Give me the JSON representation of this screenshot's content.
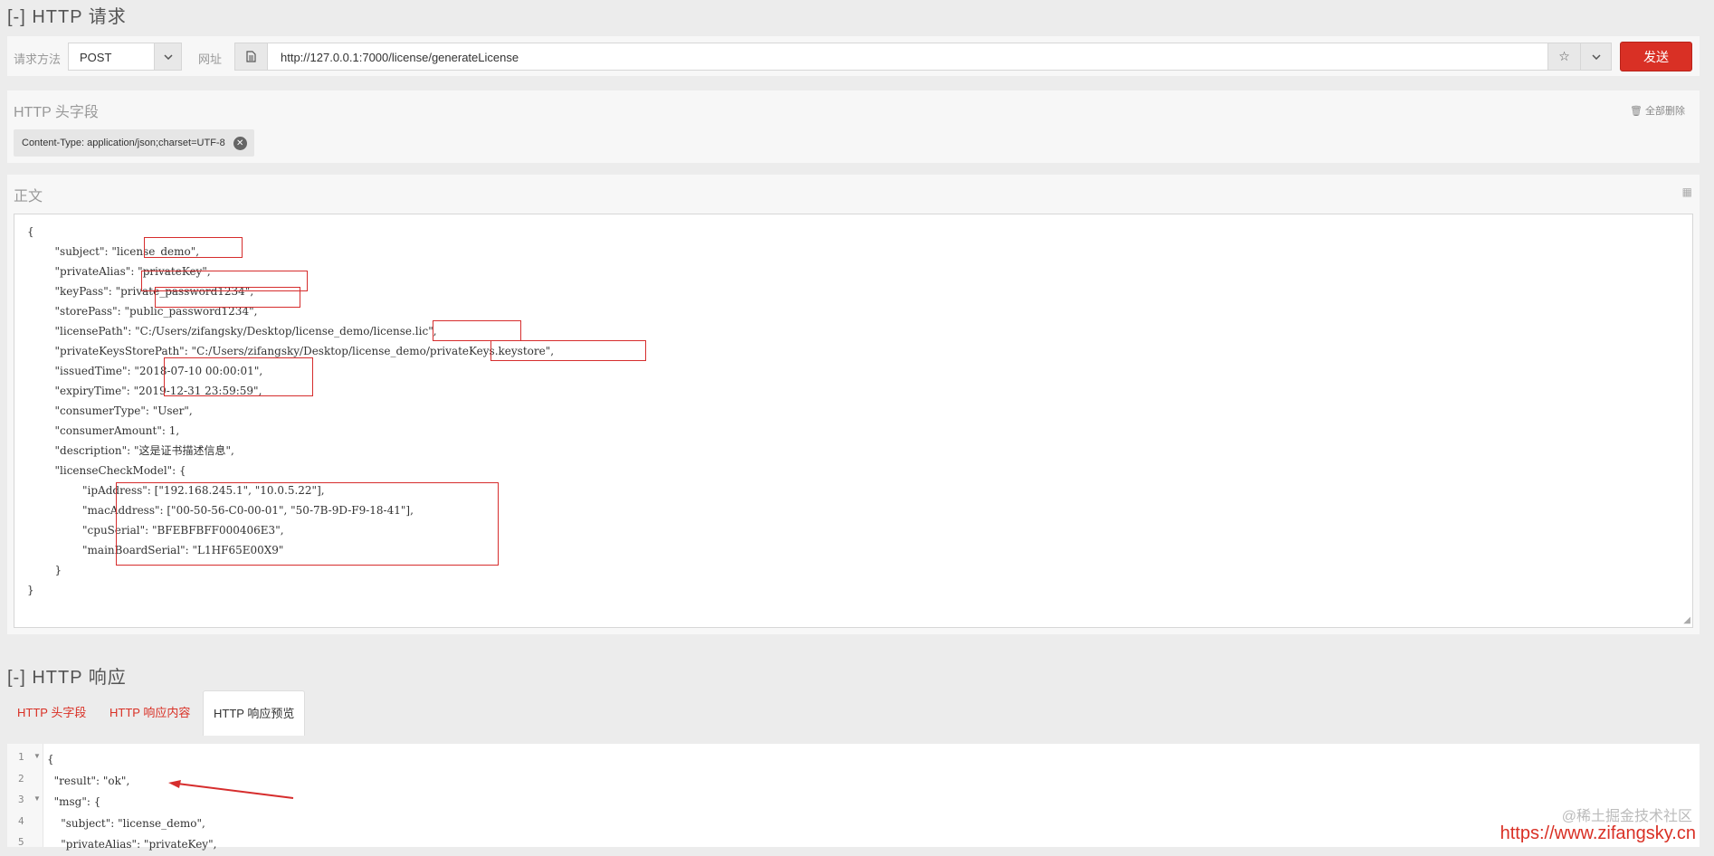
{
  "request": {
    "title": "[-]  HTTP  请求",
    "method_label": "请求方法",
    "method_value": "POST",
    "url_label": "网址",
    "url_value": "http://127.0.0.1:7000/license/generateLicense",
    "send_label": "发送"
  },
  "headers": {
    "title": "HTTP 头字段",
    "clear_all": "全部删除",
    "chips": [
      "Content-Type: application/json;charset=UTF-8"
    ]
  },
  "body": {
    "title": "正文",
    "code": "{\n        \"subject\": \"license_demo\",\n        \"privateAlias\": \"privateKey\",\n        \"keyPass\": \"private_password1234\",\n        \"storePass\": \"public_password1234\",\n        \"licensePath\": \"C:/Users/zifangsky/Desktop/license_demo/license.lic\",\n        \"privateKeysStorePath\": \"C:/Users/zifangsky/Desktop/license_demo/privateKeys.keystore\",\n        \"issuedTime\": \"2018-07-10 00:00:01\",\n        \"expiryTime\": \"2019-12-31 23:59:59\",\n        \"consumerType\": \"User\",\n        \"consumerAmount\": 1,\n        \"description\": \"这是证书描述信息\",\n        \"licenseCheckModel\": {\n                \"ipAddress\": [\"192.168.245.1\", \"10.0.5.22\"],\n                \"macAddress\": [\"00-50-56-C0-00-01\", \"50-7B-9D-F9-18-41\"],\n                \"cpuSerial\": \"BFEBFBFF000406E3\",\n                \"mainBoardSerial\": \"L1HF65E00X9\"\n        }\n}"
  },
  "response": {
    "title": "[-]  HTTP  响应",
    "tabs": [
      "HTTP 头字段",
      "HTTP 响应内容",
      "HTTP 响应预览"
    ],
    "active_tab": "HTTP 响应预览",
    "line_numbers": [
      "1",
      "2",
      "3",
      "4",
      "5"
    ],
    "code": "{\n  \"result\": \"ok\",\n  \"msg\": {\n    \"subject\": \"license_demo\",\n    \"privateAlias\": \"privateKey\","
  },
  "watermark": {
    "line1": "@稀土掘金技术社区",
    "line2": "https://www.zifangsky.cn"
  },
  "colors": {
    "accent": "#d93025",
    "highlight_box": "#d62d2d"
  },
  "icons": {
    "method_caret": "chevron-down-icon",
    "url_doc": "document-icon",
    "bookmark": "star-icon",
    "url_dropdown": "chevron-down-icon",
    "clear": "trash-icon",
    "chip_remove": "close-icon",
    "body_format": "grid-icon",
    "resize": "resize-grip-icon"
  }
}
